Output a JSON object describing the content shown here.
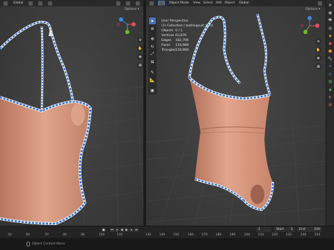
{
  "left_viewport": {
    "editor_icon": "cube-icon",
    "object_label": "",
    "orientation_label": "Global",
    "options_label": "Options ▾"
  },
  "right_viewport": {
    "mode_label": "Object Mode",
    "menus": [
      "View",
      "Select",
      "Add",
      "Object"
    ],
    "orientation_label": "Global",
    "options_label": "Options ▾",
    "stats": {
      "view_name": "User Perspective",
      "collection": "(1) Collection | bathingsuit_thick",
      "rows": [
        {
          "key": "Objects",
          "value": "0 / 1"
        },
        {
          "key": "Vertices",
          "value": "63,876"
        },
        {
          "key": "Edges",
          "value": "182,706"
        },
        {
          "key": "Faces",
          "value": "118,968"
        },
        {
          "key": "Triangles",
          "value": "118,968"
        }
      ]
    }
  },
  "timeline": {
    "ticks_left": [
      "50",
      "60",
      "70",
      "80",
      "90",
      "100",
      "110"
    ],
    "ticks_right": [
      "130",
      "140",
      "150",
      "160",
      "170",
      "180",
      "190",
      "200",
      "210",
      "220",
      "230",
      "240",
      "250"
    ],
    "current_frame": "1",
    "start_label": "Start",
    "start_value": "1",
    "end_label": "End",
    "end_value": "250"
  },
  "status_bar": {
    "hint": "Object Context Menu"
  },
  "colors": {
    "accent_blue": "#4772b3",
    "skin": "#d79a80",
    "trim_blue": "#2f6fd0",
    "axis_x": "#e84a5f",
    "axis_y": "#76b82a",
    "axis_z": "#3e86e5"
  }
}
